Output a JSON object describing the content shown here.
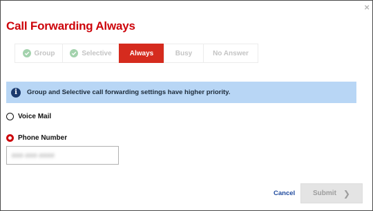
{
  "dialog": {
    "title": "Call Forwarding Always",
    "close_glyph": "×"
  },
  "tabs": [
    {
      "label": "Group",
      "state": "completed",
      "icon": "check-circle-icon"
    },
    {
      "label": "Selective",
      "state": "completed",
      "icon": "check-circle-icon"
    },
    {
      "label": "Always",
      "state": "active"
    },
    {
      "label": "Busy",
      "state": "inactive"
    },
    {
      "label": "No Answer",
      "state": "inactive"
    }
  ],
  "banner": {
    "icon": "info-icon",
    "icon_glyph": "i",
    "text": "Group and Selective call forwarding settings have higher priority."
  },
  "options": {
    "voicemail_label": "Voice Mail",
    "voicemail_selected": false,
    "phone_label": "Phone Number",
    "phone_selected": true,
    "phone_value": "###-###-####"
  },
  "actions": {
    "cancel_label": "Cancel",
    "submit_label": "Submit",
    "submit_enabled": false,
    "submit_icon": "chevron-right-icon",
    "submit_glyph": "❯"
  },
  "colors": {
    "accent_red": "#cd040b",
    "tab_active_bg": "#d52b1e",
    "banner_bg": "#b8d6f5",
    "link_blue": "#1f4a9e",
    "check_green": "#a3d2ad"
  }
}
